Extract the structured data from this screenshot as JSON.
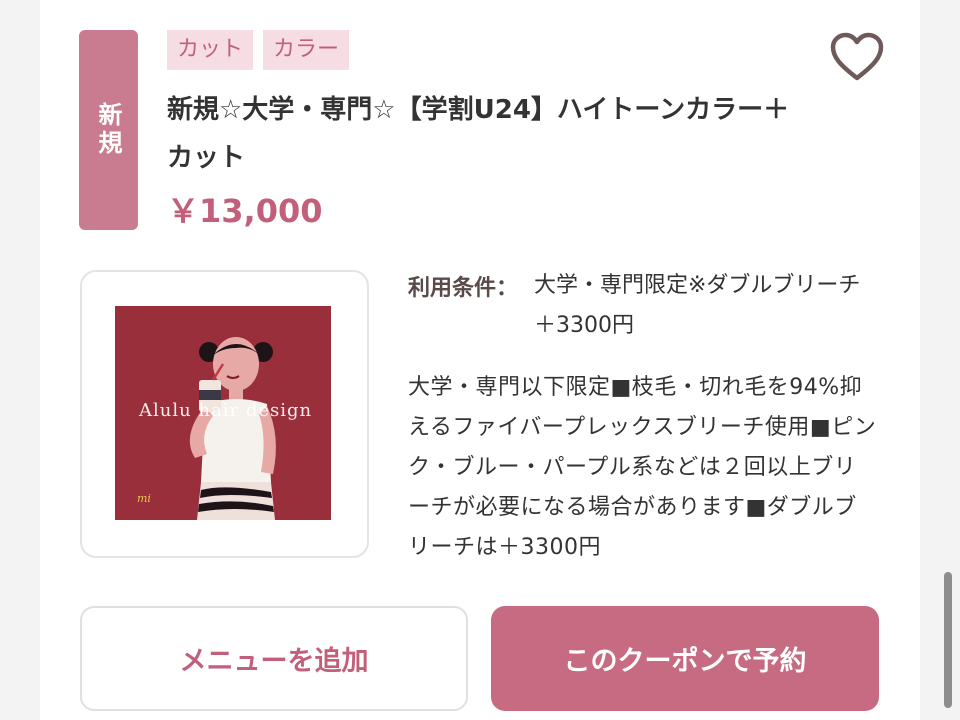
{
  "coupon": {
    "badge": "新規",
    "tags": [
      "カット",
      "カラー"
    ],
    "title": "新規☆大学・専門☆【学割U24】ハイトーンカラー＋カット",
    "price": "￥13,000",
    "favorite_icon": "heart-outline-icon",
    "image": {
      "watermark": "Alulu hair design",
      "signature": "mi"
    },
    "conditions_label": "利用条件：",
    "conditions_value": "大学・専門限定※ダブルブリーチ＋3300円",
    "description": "大学・専門以下限定■枝毛・切れ毛を94%抑えるファイバープレックスブリーチ使用■ピンク・ブルー・パープル系などは２回以上ブリーチが必要になる場合があります■ダブルブリーチは＋3300円"
  },
  "actions": {
    "add_menu_label": "メニューを追加",
    "reserve_label": "このクーポンで予約"
  },
  "colors": {
    "accent": "#c2607c",
    "badge": "#c97b90",
    "tag_bg": "#f6dde4",
    "reserve_button": "#c76b82"
  }
}
